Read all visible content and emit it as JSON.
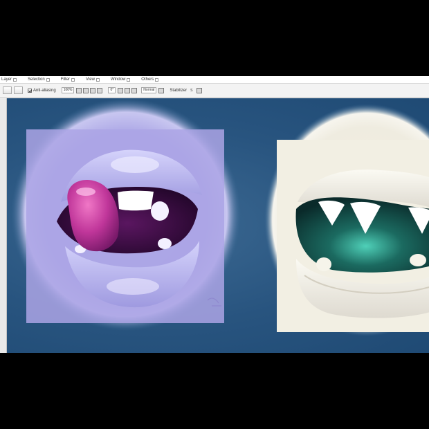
{
  "menubar": {
    "items": [
      "Layer",
      "Selection",
      "Filter",
      "View",
      "Window",
      "Others"
    ]
  },
  "toolbar": {
    "checkbox_label": "Anti-aliasing",
    "zoom_value": "100%",
    "angle_value": "0°",
    "blend_mode": "Normal",
    "stabilizer_label": "Stabilizer",
    "stabilizer_value": "S"
  },
  "canvas": {
    "background_color": "#28547f",
    "artworks": [
      "purple-lips-with-tongue",
      "pale-lips-with-fangs"
    ]
  }
}
